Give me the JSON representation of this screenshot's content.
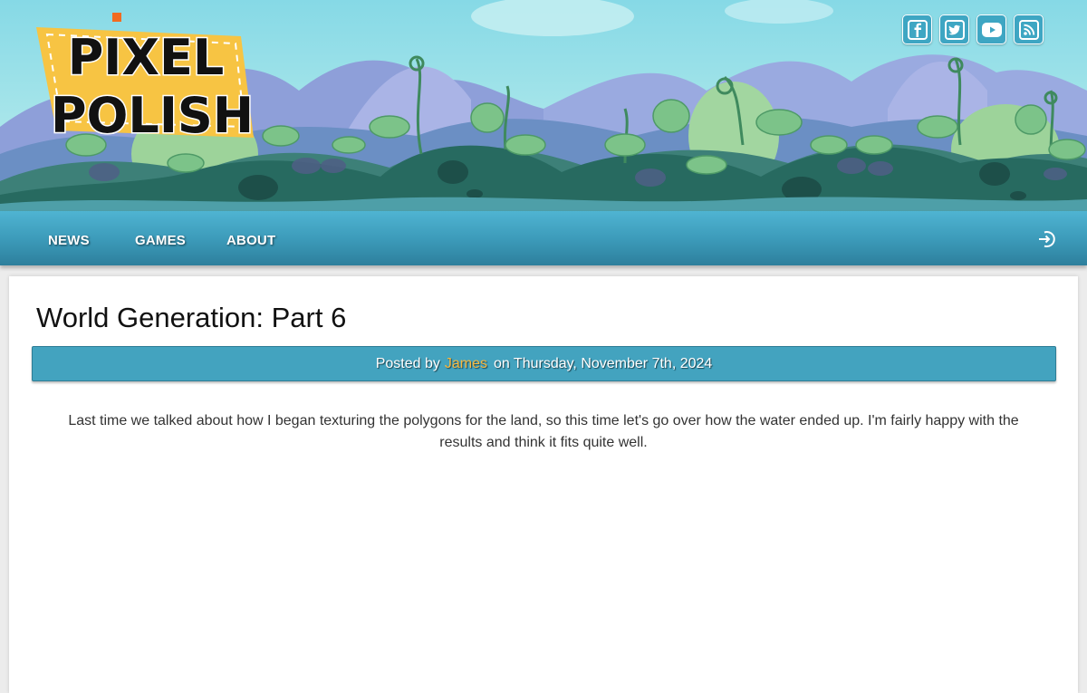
{
  "brand": {
    "logo_line1": "PIXEL",
    "logo_line2": "POLISH",
    "accent": "#f7c443",
    "dot": "#f26b21"
  },
  "social": [
    {
      "icon": "facebook-icon"
    },
    {
      "icon": "twitter-icon"
    },
    {
      "icon": "youtube-icon"
    },
    {
      "icon": "rss-icon"
    }
  ],
  "nav": {
    "items": [
      {
        "label": "NEWS"
      },
      {
        "label": "GAMES"
      },
      {
        "label": "ABOUT"
      }
    ],
    "login_icon": "login-icon"
  },
  "post": {
    "title": "World Generation: Part 6",
    "posted_by_prefix": "Posted by",
    "author": "James",
    "date_text": "on Thursday, November 7th, 2024",
    "body": "Last time we talked about how I began texturing the polygons for the land, so this time let's go over how the water ended up.  I'm fairly happy with the results and think it fits quite well."
  },
  "colors": {
    "nav": "#3b99b8",
    "author": "#f5b942",
    "postbar": "#43a3bf"
  }
}
